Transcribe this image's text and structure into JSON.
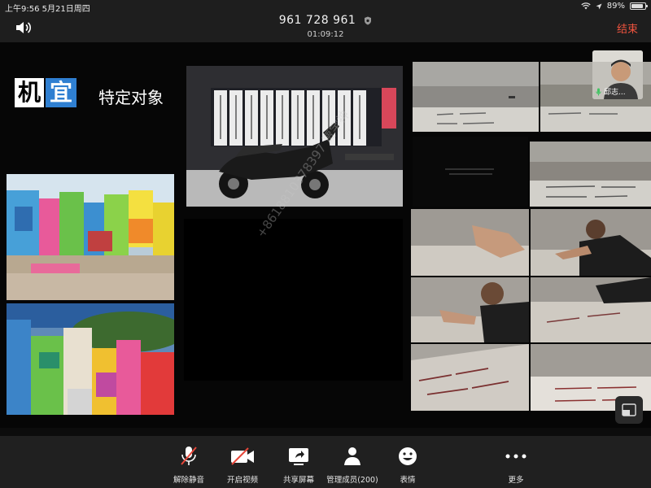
{
  "status_bar": {
    "time_date": "上午9:56  5月21日周四",
    "battery": "89%",
    "battery_level": 0.89
  },
  "header": {
    "meeting_id": "961 728 961",
    "elapsed": "01:09:12",
    "end_label": "结束"
  },
  "slide": {
    "title_part1": "机",
    "title_part2": "宜",
    "subtitle": "特定对象",
    "watermark": "+8618810378397 贾宇神"
  },
  "participant": {
    "name": "邱志..."
  },
  "toolbar": {
    "mute": "解除静音",
    "video": "开启视频",
    "share": "共享屏幕",
    "members": "管理成员(200)",
    "reactions": "表情",
    "more": "更多"
  },
  "colors": {
    "end_red": "#f0543f",
    "title_blue": "#2f7fd1",
    "muted_red": "#e8473a",
    "toolbar_bg": "#202020"
  }
}
